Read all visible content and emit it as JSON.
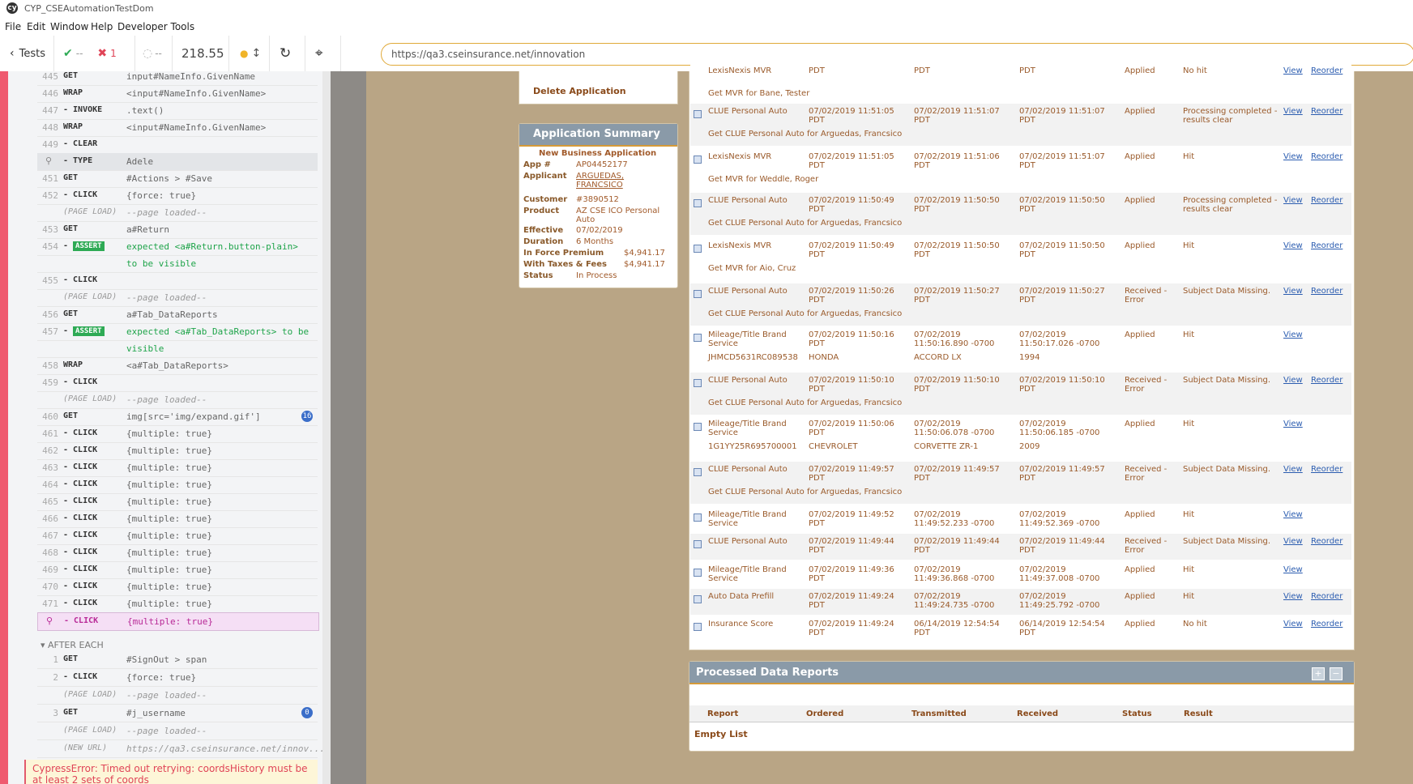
{
  "window": {
    "title": "CYP_CSEAutomationTestDom",
    "menu": [
      "File",
      "Edit",
      "Window",
      "Help",
      "Developer Tools"
    ]
  },
  "toolbar": {
    "tests_label": "Tests",
    "passed": "--",
    "failed": "1",
    "pending": "--",
    "duration": "218.55",
    "url": "https://qa3.cseinsurance.net/innovation"
  },
  "commands": [
    {
      "n": "445",
      "name": "GET",
      "msg": "input#NameInfo.GivenName"
    },
    {
      "n": "446",
      "name": "WRAP",
      "msg": "<input#NameInfo.GivenName>"
    },
    {
      "n": "447",
      "name": "- INVOKE",
      "msg": ".text()"
    },
    {
      "n": "448",
      "name": "WRAP",
      "msg": "<input#NameInfo.GivenName>"
    },
    {
      "n": "449",
      "name": "- CLEAR",
      "msg": ""
    },
    {
      "n": "",
      "name": "- TYPE",
      "msg": "Adele"
    },
    {
      "n": "451",
      "name": "GET",
      "msg": "#Actions > #Save"
    },
    {
      "n": "452",
      "name": "- CLICK",
      "msg": "{force: true}"
    },
    {
      "n": "",
      "name": "(PAGE LOAD)",
      "msg": "--page loaded--"
    },
    {
      "n": "453",
      "name": "GET",
      "msg": "a#Return"
    },
    {
      "n": "454",
      "name": "- ASSERT",
      "msg": "expected <a#Return.button-plain>"
    },
    {
      "n": "",
      "name": "",
      "msg": "to be visible"
    },
    {
      "n": "455",
      "name": "- CLICK",
      "msg": ""
    },
    {
      "n": "",
      "name": "(PAGE LOAD)",
      "msg": "--page loaded--"
    },
    {
      "n": "456",
      "name": "GET",
      "msg": "a#Tab_DataReports"
    },
    {
      "n": "457",
      "name": "- ASSERT",
      "msg": "expected <a#Tab_DataReports> to be"
    },
    {
      "n": "",
      "name": "",
      "msg": "visible"
    },
    {
      "n": "458",
      "name": "WRAP",
      "msg": "<a#Tab_DataReports>"
    },
    {
      "n": "459",
      "name": "- CLICK",
      "msg": ""
    },
    {
      "n": "",
      "name": "(PAGE LOAD)",
      "msg": "--page loaded--"
    },
    {
      "n": "460",
      "name": "GET",
      "msg": "img[src='img/expand.gif']"
    },
    {
      "n": "461",
      "name": "- CLICK",
      "msg": "{multiple: true}"
    },
    {
      "n": "462",
      "name": "- CLICK",
      "msg": "{multiple: true}"
    },
    {
      "n": "463",
      "name": "- CLICK",
      "msg": "{multiple: true}"
    },
    {
      "n": "464",
      "name": "- CLICK",
      "msg": "{multiple: true}"
    },
    {
      "n": "465",
      "name": "- CLICK",
      "msg": "{multiple: true}"
    },
    {
      "n": "466",
      "name": "- CLICK",
      "msg": "{multiple: true}"
    },
    {
      "n": "467",
      "name": "- CLICK",
      "msg": "{multiple: true}"
    },
    {
      "n": "468",
      "name": "- CLICK",
      "msg": "{multiple: true}"
    },
    {
      "n": "469",
      "name": "- CLICK",
      "msg": "{multiple: true}"
    },
    {
      "n": "470",
      "name": "- CLICK",
      "msg": "{multiple: true}"
    },
    {
      "n": "471",
      "name": "- CLICK",
      "msg": "{multiple: true}"
    },
    {
      "n": "",
      "name": "- CLICK",
      "msg": "{multiple: true}"
    }
  ],
  "badge_460": "16",
  "after_each": {
    "label": "AFTER EACH",
    "cmds": [
      {
        "n": "1",
        "name": "GET",
        "msg": "#SignOut > span"
      },
      {
        "n": "2",
        "name": "- CLICK",
        "msg": "{force: true}"
      },
      {
        "n": "",
        "name": "(PAGE LOAD)",
        "msg": "--page loaded--"
      },
      {
        "n": "3",
        "name": "GET",
        "msg": "#j_username"
      },
      {
        "n": "",
        "name": "(PAGE LOAD)",
        "msg": "--page loaded--"
      },
      {
        "n": "",
        "name": "(NEW URL)",
        "msg": "https://qa3.cseinsurance.net/innov..."
      }
    ],
    "badge": "0"
  },
  "error": "CypressError: Timed out retrying: coordsHistory must be at least 2 sets of coords",
  "left_app": {
    "delete_app": "Delete Application",
    "summary_title": "Application Summary",
    "summary_heading": "New Business Application",
    "rows": [
      {
        "k": "App #",
        "v": "AP04452177"
      },
      {
        "k": "Applicant",
        "v": "ARGUEDAS, FRANCSICO"
      },
      {
        "k": "Customer",
        "v": "#3890512"
      },
      {
        "k": "Product",
        "v": "AZ CSE ICO Personal Auto"
      },
      {
        "k": "Effective",
        "v": "07/02/2019"
      },
      {
        "k": "Duration",
        "v": "6 Months"
      },
      {
        "k": "In Force Premium",
        "v": "$4,941.17"
      },
      {
        "k": "With Taxes & Fees",
        "v": "$4,941.17"
      },
      {
        "k": "Status",
        "v": "In Process"
      }
    ]
  },
  "reports": [
    {
      "name": "LexisNexis MVR",
      "o": "PDT",
      "t": "PDT",
      "r": "PDT",
      "s": "Applied",
      "res": "No hit",
      "view": "View",
      "reorder": "Reorder",
      "sub": "Get MVR for Bane, Tester"
    },
    {
      "name": "CLUE Personal Auto",
      "o": "07/02/2019 11:51:05 PDT",
      "t": "07/02/2019 11:51:07 PDT",
      "r": "07/02/2019 11:51:07 PDT",
      "s": "Applied",
      "res": "Processing completed - results clear",
      "view": "View",
      "reorder": "Reorder",
      "sub": "Get CLUE Personal Auto for Arguedas, Francsico"
    },
    {
      "name": "LexisNexis MVR",
      "o": "07/02/2019 11:51:05 PDT",
      "t": "07/02/2019 11:51:06 PDT",
      "r": "07/02/2019 11:51:07 PDT",
      "s": "Applied",
      "res": "Hit",
      "view": "View",
      "reorder": "Reorder",
      "sub": "Get MVR for Weddle, Roger"
    },
    {
      "name": "CLUE Personal Auto",
      "o": "07/02/2019 11:50:49 PDT",
      "t": "07/02/2019 11:50:50 PDT",
      "r": "07/02/2019 11:50:50 PDT",
      "s": "Applied",
      "res": "Processing completed - results clear",
      "view": "View",
      "reorder": "Reorder",
      "sub": "Get CLUE Personal Auto for Arguedas, Francsico"
    },
    {
      "name": "LexisNexis MVR",
      "o": "07/02/2019 11:50:49 PDT",
      "t": "07/02/2019 11:50:50 PDT",
      "r": "07/02/2019 11:50:50 PDT",
      "s": "Applied",
      "res": "Hit",
      "view": "View",
      "reorder": "Reorder",
      "sub": "Get MVR for Aio, Cruz"
    },
    {
      "name": "CLUE Personal Auto",
      "o": "07/02/2019 11:50:26 PDT",
      "t": "07/02/2019 11:50:27 PDT",
      "r": "07/02/2019 11:50:27 PDT",
      "s": "Received - Error",
      "res": "Subject Data Missing.",
      "view": "View",
      "reorder": "Reorder",
      "sub": "Get CLUE Personal Auto for Arguedas, Francsico"
    },
    {
      "name": "Mileage/Title Brand Service",
      "o": "07/02/2019 11:50:16 PDT",
      "t": "07/02/2019 11:50:16.890 -0700",
      "r": "07/02/2019 11:50:17.026 -0700",
      "s": "Applied",
      "res": "Hit",
      "view": "View",
      "reorder": "",
      "veh": [
        "JHMCD5631RC089538",
        "HONDA",
        "ACCORD LX",
        "1994"
      ]
    },
    {
      "name": "CLUE Personal Auto",
      "o": "07/02/2019 11:50:10 PDT",
      "t": "07/02/2019 11:50:10 PDT",
      "r": "07/02/2019 11:50:10 PDT",
      "s": "Received - Error",
      "res": "Subject Data Missing.",
      "view": "View",
      "reorder": "Reorder",
      "sub": "Get CLUE Personal Auto for Arguedas, Francsico"
    },
    {
      "name": "Mileage/Title Brand Service",
      "o": "07/02/2019 11:50:06 PDT",
      "t": "07/02/2019 11:50:06.078 -0700",
      "r": "07/02/2019 11:50:06.185 -0700",
      "s": "Applied",
      "res": "Hit",
      "view": "View",
      "reorder": "",
      "veh": [
        "1G1YY25R695700001",
        "CHEVROLET",
        "CORVETTE ZR-1",
        "2009"
      ]
    },
    {
      "name": "CLUE Personal Auto",
      "o": "07/02/2019 11:49:57 PDT",
      "t": "07/02/2019 11:49:57 PDT",
      "r": "07/02/2019 11:49:57 PDT",
      "s": "Received - Error",
      "res": "Subject Data Missing.",
      "view": "View",
      "reorder": "Reorder",
      "sub": "Get CLUE Personal Auto for Arguedas, Francsico"
    },
    {
      "name": "Mileage/Title Brand Service",
      "o": "07/02/2019 11:49:52 PDT",
      "t": "07/02/2019 11:49:52.233 -0700",
      "r": "07/02/2019 11:49:52.369 -0700",
      "s": "Applied",
      "res": "Hit",
      "view": "View",
      "reorder": ""
    },
    {
      "name": "CLUE Personal Auto",
      "o": "07/02/2019 11:49:44 PDT",
      "t": "07/02/2019 11:49:44 PDT",
      "r": "07/02/2019 11:49:44 PDT",
      "s": "Received - Error",
      "res": "Subject Data Missing.",
      "view": "View",
      "reorder": "Reorder"
    },
    {
      "name": "Mileage/Title Brand Service",
      "o": "07/02/2019 11:49:36 PDT",
      "t": "07/02/2019 11:49:36.868 -0700",
      "r": "07/02/2019 11:49:37.008 -0700",
      "s": "Applied",
      "res": "Hit",
      "view": "View",
      "reorder": ""
    },
    {
      "name": "Auto Data Prefill",
      "o": "07/02/2019 11:49:24 PDT",
      "t": "07/02/2019 11:49:24.735 -0700",
      "r": "07/02/2019 11:49:25.792 -0700",
      "s": "Applied",
      "res": "Hit",
      "view": "View",
      "reorder": "Reorder"
    },
    {
      "name": "Insurance Score",
      "o": "07/02/2019 11:49:24 PDT",
      "t": "06/14/2019 12:54:54 PDT",
      "r": "06/14/2019 12:54:54 PDT",
      "s": "Applied",
      "res": "No hit",
      "view": "View",
      "reorder": "Reorder"
    }
  ],
  "processed": {
    "title": "Processed Data Reports",
    "cols": [
      "Report",
      "Ordered",
      "Transmitted",
      "Received",
      "Status",
      "Result"
    ],
    "empty": "Empty List"
  }
}
